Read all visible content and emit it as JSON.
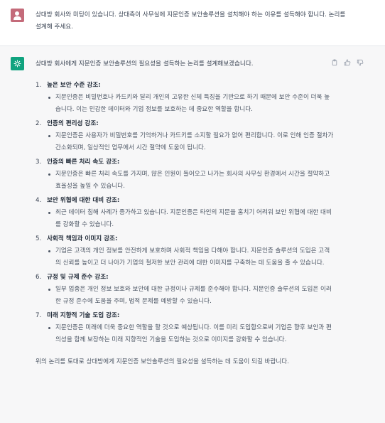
{
  "user_message": "상대방 회사와 미팅이 있습니다. 상대측이 사무실에 지문인증 보안솔루션을 설치해야 하는 이유를 설득해야 합니다. 논리를 설계해 주세요.",
  "assistant": {
    "intro": "상대방 회사에게 지문인증 보안솔루션의 필요성을 설득하는 논리를 설계해보겠습니다.",
    "items": [
      {
        "num": "1.",
        "title": "높은 보안 수준 강조:",
        "detail": "지문인증은 비밀번호나 카드키와 달리 개인의 고유한 신체 특징을 기반으로 하기 때문에 보안 수준이 더욱 높습니다. 이는 민감한 데이터와 기업 정보를 보호하는 데 중요한 역할을 합니다."
      },
      {
        "num": "2.",
        "title": "인증의 편리성 강조:",
        "detail": "지문인증은 사용자가 비밀번호를 기억하거나 카드키를 소지할 필요가 없어 편리합니다. 이로 인해 인증 절차가 간소화되며, 일상적인 업무에서 시간 절약에 도움이 됩니다."
      },
      {
        "num": "3.",
        "title": "인증의 빠른 처리 속도 강조:",
        "detail": "지문인증은 빠른 처리 속도를 가지며, 많은 인원이 들어오고 나가는 회사의 사무실 환경에서 시간을 절약하고 효율성을 높일 수 있습니다."
      },
      {
        "num": "4.",
        "title": "보안 위협에 대한 대비 강조:",
        "detail": "최근 데이터 침해 사례가 증가하고 있습니다. 지문인증은 타인의 지문을 훔치기 어려워 보안 위협에 대한 대비를 강화할 수 있습니다."
      },
      {
        "num": "5.",
        "title": "사회적 책임과 이미지 강조:",
        "detail": "기업은 고객의 개인 정보를 안전하게 보호하며 사회적 책임을 다해야 합니다. 지문인증 솔루션의 도입은 고객의 신뢰를 높이고 더 나아가 기업의 철저한 보안 관리에 대한 이미지를 구축하는 데 도움을 줄 수 있습니다."
      },
      {
        "num": "6.",
        "title": "규정 및 규제 준수 강조:",
        "detail": "일부 업종은 개인 정보 보호와 보안에 대한 규정이나 규제를 준수해야 합니다. 지문인증 솔루션의 도입은 이러한 규정 준수에 도움을 주며, 법적 문제를 예방할 수 있습니다."
      },
      {
        "num": "7.",
        "title": "미래 지향적 기술 도입 강조:",
        "detail": "지문인증은 미래에 더욱 중요한 역할을 할 것으로 예상됩니다. 이를 미리 도입함으로써 기업은 향후 보안과 편의성을 함께 보장하는 미래 지향적인 기술을 도입하는 것으로 이미지를 강화할 수 있습니다."
      }
    ],
    "outro": "위의 논리를 토대로 상대방에게 지문인증 보안솔루션의 필요성을 설득하는 데 도움이 되길 바랍니다."
  },
  "icons": {
    "copy": "clipboard-icon",
    "like": "thumbs-up-icon",
    "dislike": "thumbs-down-icon"
  },
  "colors": {
    "brand": "#10a37f",
    "user_avatar": "#c46b7a",
    "assistant_bg": "#f7f7f8"
  }
}
